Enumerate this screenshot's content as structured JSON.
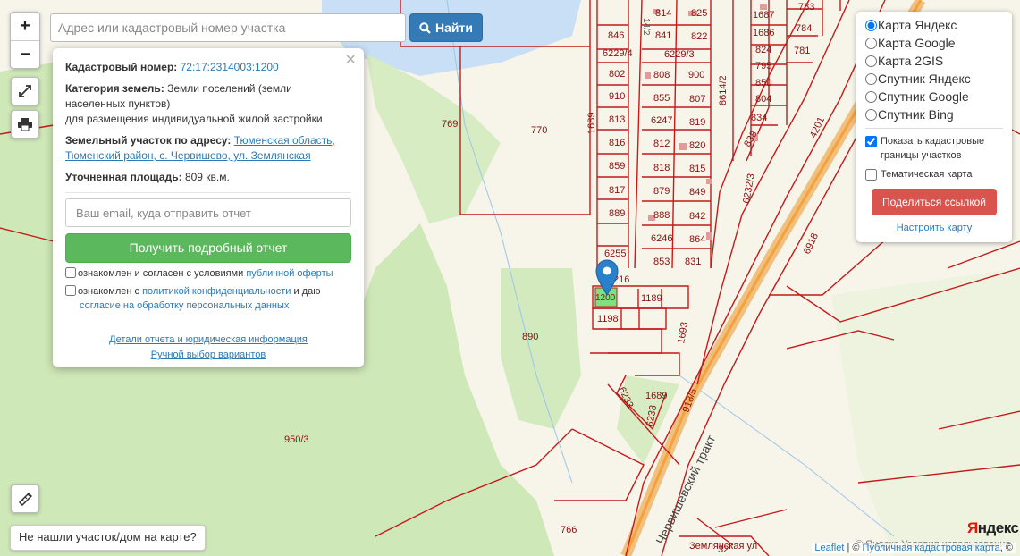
{
  "search": {
    "placeholder": "Адрес или кадастровый номер участка",
    "button_label": "Найти"
  },
  "zoom": {
    "in_label": "+",
    "out_label": "−"
  },
  "popup": {
    "close": "×",
    "cadastral_label": "Кадастровый номер:",
    "cadastral_value": "72:17:2314003:1200",
    "category_label": "Категория земель:",
    "category_value": "Земли поселений (земли населенных пунктов)",
    "usage": "для размещения индивидуальной жилой застройки",
    "address_label": "Земельный участок по адресу:",
    "address_value": "Тюменская область, Тюменский район, с. Червишево, ул. Землянская",
    "area_label": "Уточненная площадь:",
    "area_value": "809 кв.м.",
    "email_placeholder": "Ваш email, куда отправить отчет",
    "get_report": "Получить подробный отчет",
    "agree1_text": "ознакомлен и согласен с условиями",
    "agree1_link": "публичной оферты",
    "agree2_text": "ознакомлен с",
    "agree2_link": "политикой конфиденциальности",
    "agree2_mid": "и даю",
    "agree2_link2": "согласие на обработку персональных данных",
    "details_link": "Детали отчета и юридическая информация",
    "manual_link": "Ручной выбор вариантов"
  },
  "layers": {
    "options": [
      "Карта Яндекс",
      "Карта Google",
      "Карта 2GIS",
      "Спутник Яндекс",
      "Спутник Google",
      "Спутник Bing"
    ],
    "selected": "Карта Яндекс",
    "show_borders": "Показать кадастровые границы участков",
    "show_borders_checked": true,
    "thematic": "Тематическая карта",
    "thematic_checked": false,
    "share": "Поделиться ссылкой",
    "configure": "Настроить карту"
  },
  "not_found": "Не нашли участок/дом на карте?",
  "yandex_logo": {
    "first": "Я",
    "rest": "ндекс"
  },
  "yandex_terms": "© Яндекс Условия использования",
  "attribution": {
    "leaflet": "Leaflet",
    "sep": " | © ",
    "pkk": "Публичная кадастровая карта",
    "end": ", ©"
  },
  "marker_label": "1200",
  "map_labels": [
    "814",
    "825",
    "1687",
    "783",
    "846",
    "841",
    "822",
    "1686",
    "784",
    "6229/4",
    "6229/3",
    "824",
    "781",
    "802",
    "808",
    "900",
    "795",
    "910",
    "855",
    "807",
    "850",
    "8614/2",
    "813",
    "6247",
    "819",
    "804",
    "834",
    "816",
    "812",
    "820",
    "838",
    "859",
    "818",
    "815",
    "4201",
    "817",
    "879",
    "849",
    "6232/3",
    "889",
    "888",
    "842",
    "6246",
    "864",
    "6255",
    "853",
    "831",
    "6918",
    "769",
    "770",
    "1689",
    "1189",
    "1198",
    "890",
    "1693",
    "1689",
    "6233",
    "6233",
    "918/5",
    "950/3",
    "766",
    "Червишевский тракт",
    "Землянская ул",
    "32",
    "216",
    "14/2"
  ],
  "colors": {
    "parcel": "#c41a1a",
    "forest": "#cfe8b8",
    "water": "#c9dff5",
    "road": "#f3b25a",
    "marker": "#2a81cb",
    "selected": "#7ee07e"
  }
}
